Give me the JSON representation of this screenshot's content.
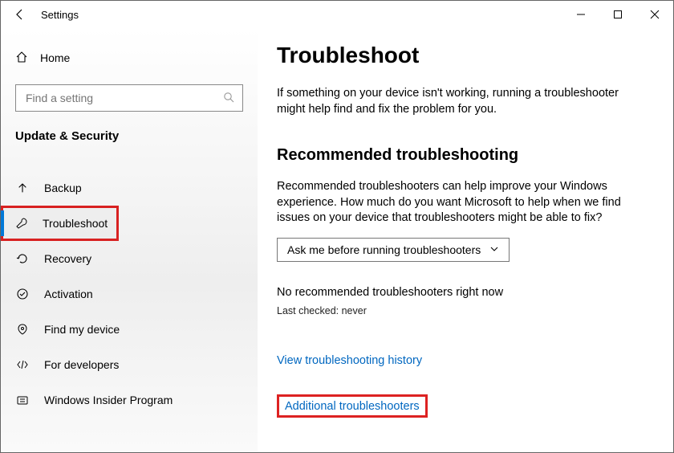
{
  "window": {
    "title": "Settings"
  },
  "sidebar": {
    "home_label": "Home",
    "search_placeholder": "Find a setting",
    "section_label": "Update & Security",
    "items": [
      {
        "label": "Backup"
      },
      {
        "label": "Troubleshoot"
      },
      {
        "label": "Recovery"
      },
      {
        "label": "Activation"
      },
      {
        "label": "Find my device"
      },
      {
        "label": "For developers"
      },
      {
        "label": "Windows Insider Program"
      }
    ]
  },
  "content": {
    "page_title": "Troubleshoot",
    "page_subtitle": "If something on your device isn't working, running a troubleshooter might help find and fix the problem for you.",
    "rec_heading": "Recommended troubleshooting",
    "rec_text": "Recommended troubleshooters can help improve your Windows experience. How much do you want Microsoft to help when we find issues on your device that troubleshooters might be able to fix?",
    "dropdown_value": "Ask me before running troubleshooters",
    "no_rec_text": "No recommended troubleshooters right now",
    "last_checked_text": "Last checked: never",
    "link_history": "View troubleshooting history",
    "link_additional": "Additional troubleshooters"
  }
}
